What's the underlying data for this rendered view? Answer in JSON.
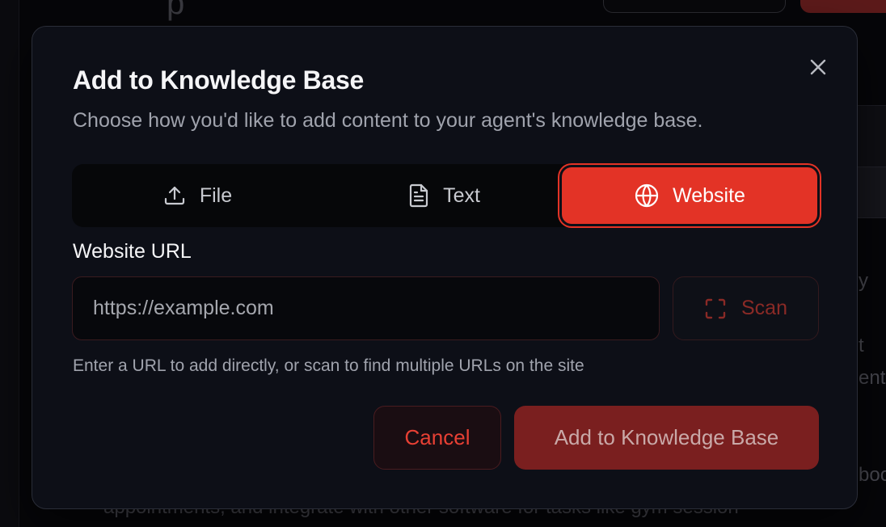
{
  "background": {
    "title_fragment": "p",
    "text_fragments": [
      {
        "id": "frag-y",
        "text": "y"
      },
      {
        "id": "frag-t",
        "text": "t"
      },
      {
        "id": "frag-ent",
        "text": "ent"
      },
      {
        "id": "frag-boo",
        "text": "boo"
      },
      {
        "id": "frag-line",
        "text": "appointments, and integrate with other software for tasks like gym session"
      }
    ]
  },
  "modal": {
    "title": "Add to Knowledge Base",
    "description": "Choose how you'd like to add content to your agent's knowledge base.",
    "close_icon": "close-icon",
    "tabs": [
      {
        "label": "File",
        "icon": "upload-icon"
      },
      {
        "label": "Text",
        "icon": "document-icon"
      },
      {
        "label": "Website",
        "icon": "globe-icon",
        "selected": true
      }
    ],
    "url_field": {
      "label": "Website URL",
      "value": "",
      "placeholder": "https://example.com"
    },
    "scan_button": {
      "label": "Scan",
      "icon": "scan-frame-icon"
    },
    "helper_text": "Enter a URL to add directly, or scan to find multiple URLs on the site",
    "cancel_label": "Cancel",
    "submit_label": "Add to Knowledge Base"
  },
  "colors": {
    "accent": "#e33326",
    "modal_bg": "#0d0f17",
    "disabled_submit": "#7a1f1f"
  }
}
